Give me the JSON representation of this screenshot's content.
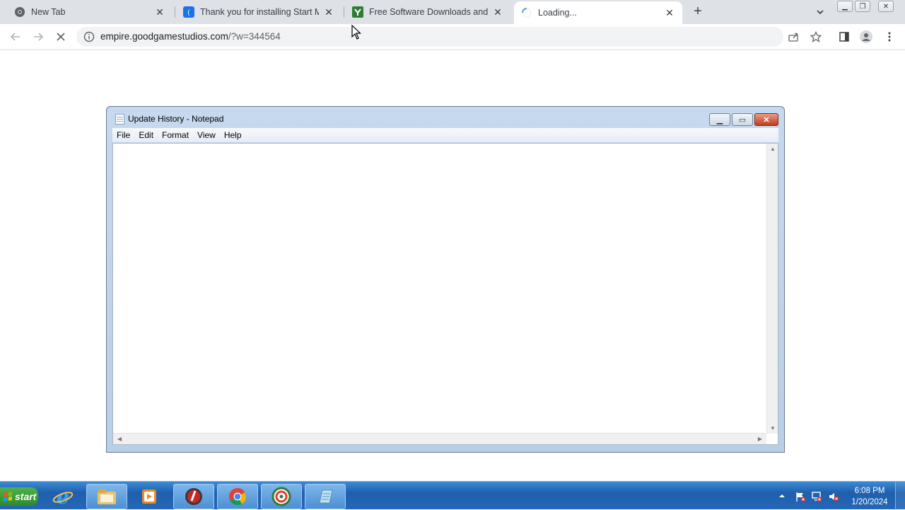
{
  "browser": {
    "tabs": [
      {
        "title": "New Tab",
        "icon": "chrome-icon"
      },
      {
        "title": "Thank you for installing Start Me",
        "icon": "startme-icon"
      },
      {
        "title": "Free Software Downloads and Re",
        "icon": "softonic-icon"
      },
      {
        "title": "Loading...",
        "icon": "loading-spinner-icon"
      }
    ],
    "url_host": "empire.goodgamestudios.com",
    "url_path": "/?w=344564"
  },
  "notepad": {
    "title": "Update History - Notepad",
    "menu": [
      "File",
      "Edit",
      "Format",
      "View",
      "Help"
    ],
    "content": ""
  },
  "taskbar": {
    "start_label": "start",
    "time": "6:08 PM",
    "date": "1/20/2024"
  },
  "colors": {
    "chrome_strip": "#dee1e6",
    "taskbar": "#2566b6",
    "start_green": "#3c9d38"
  }
}
